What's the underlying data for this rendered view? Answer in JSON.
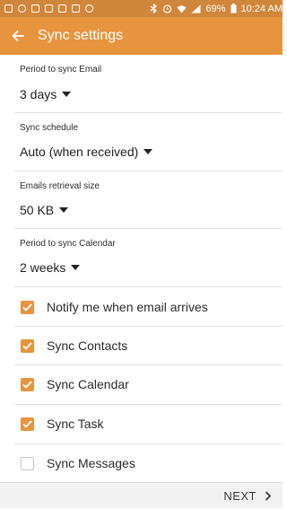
{
  "status_bar": {
    "battery": "69%",
    "time": "10:24 AM"
  },
  "app_bar": {
    "title": "Sync settings"
  },
  "fields": [
    {
      "label": "Period to sync Email",
      "value": "3 days"
    },
    {
      "label": "Sync schedule",
      "value": "Auto (when received)"
    },
    {
      "label": "Emails retrieval size",
      "value": "50 KB"
    },
    {
      "label": "Period to sync Calendar",
      "value": "2 weeks"
    }
  ],
  "checks": [
    {
      "label": "Notify me when email arrives",
      "checked": true
    },
    {
      "label": "Sync Contacts",
      "checked": true
    },
    {
      "label": "Sync Calendar",
      "checked": true
    },
    {
      "label": "Sync Task",
      "checked": true
    },
    {
      "label": "Sync Messages",
      "checked": false
    }
  ],
  "footer": {
    "next_label": "NEXT"
  },
  "colors": {
    "accent": "#e7943f",
    "status_bar": "#d0873b"
  }
}
